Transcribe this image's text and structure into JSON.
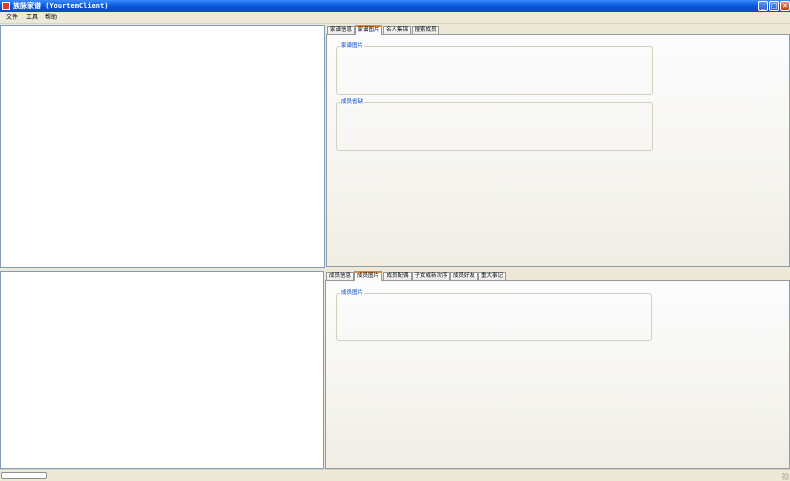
{
  "window": {
    "title": "族脉家谱 (YourtemClient)",
    "buttons": {
      "minimize": "_",
      "maximize": "□",
      "close": "✕"
    }
  },
  "menu": [
    "文件",
    "工具",
    "帮助"
  ],
  "top_tabs": {
    "items": [
      "家谱信息",
      "家谱图片",
      "名人集锦",
      "搜索成员"
    ],
    "selected": "家谱图片"
  },
  "top_panel": {
    "groups": [
      "家谱图片",
      "成员省缺"
    ]
  },
  "bottom_tabs": {
    "items": [
      "成员信息",
      "成员图片",
      "成员配偶",
      "子女或新次序",
      "成员好友",
      "重大事记"
    ],
    "selected": "成员图片"
  },
  "bottom_panel": {
    "groups": [
      "成员图片"
    ]
  },
  "status": {
    "progress": 0
  }
}
